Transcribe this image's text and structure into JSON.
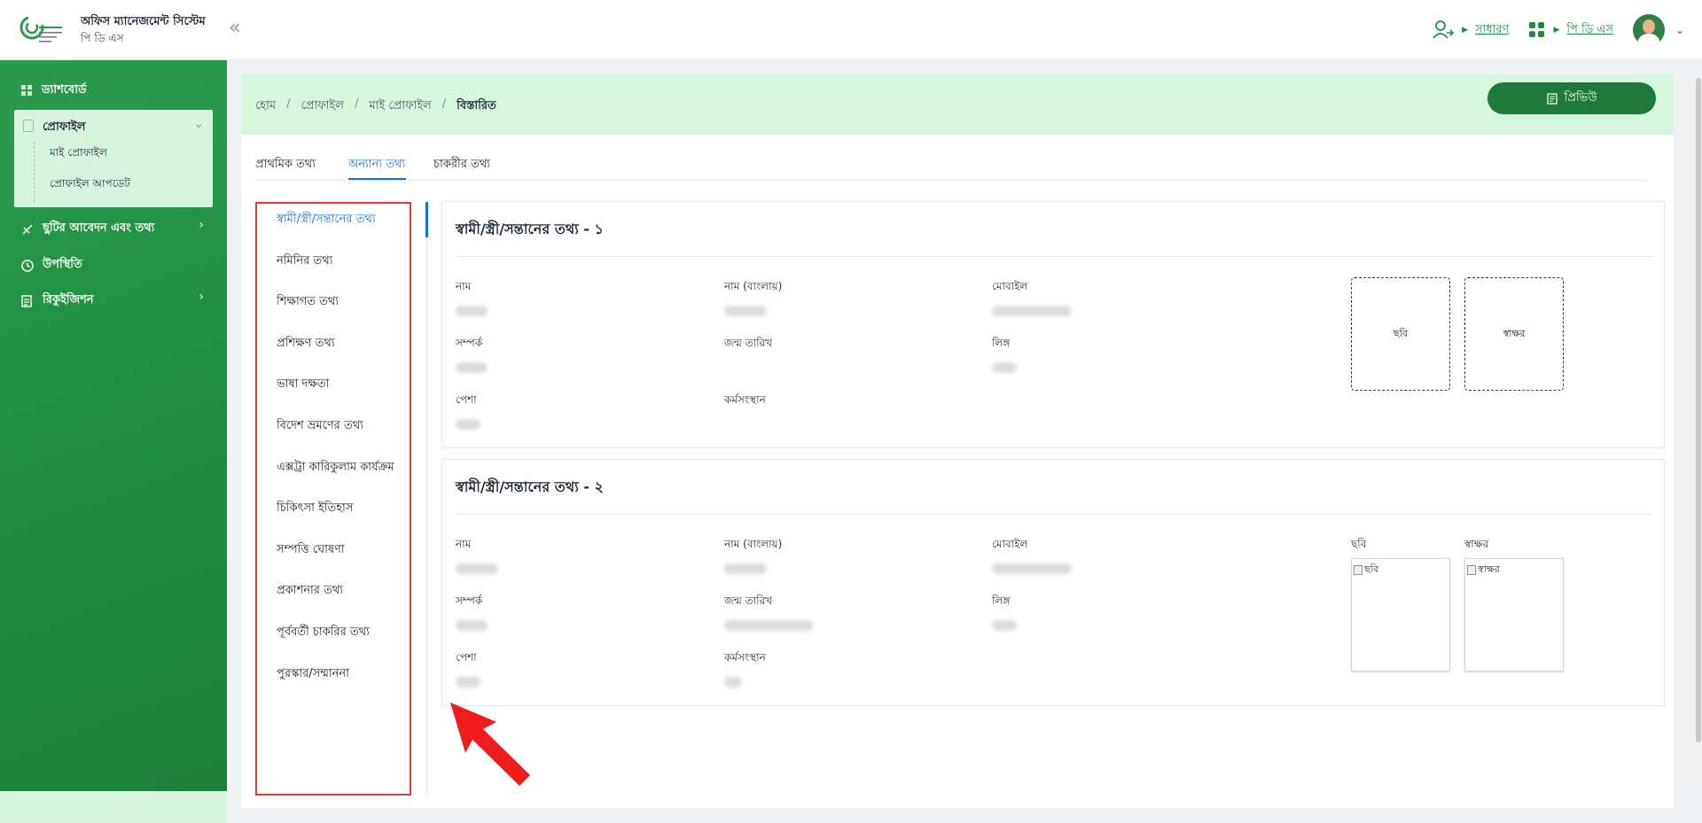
{
  "header": {
    "app_title": "অফিস ম্যানেজমেন্ট সিস্টেম",
    "app_subtitle": "পি ডি এস",
    "role_link": "সাধারণ",
    "module_link": "পি ডি এস",
    "accent": "#1a8f3e"
  },
  "sidebar": {
    "dashboard": "ড্যাশবোর্ড",
    "profile": "প্রোফাইল",
    "my_profile": "মাই প্রোফাইল",
    "profile_update": "প্রোফাইল আপডেট",
    "leave": "ছুটির আবেদন এবং তথ্য",
    "attendance": "উপস্থিতি",
    "requisition": "রিকুইজিশন"
  },
  "breadcrumb": {
    "home": "হোম",
    "profile": "প্রোফাইল",
    "my_profile": "মাই প্রোফাইল",
    "current": "বিস্তারিত"
  },
  "preview_button": "প্রিভিউ",
  "tabs": {
    "basic": "প্রাথমিক তথ্য",
    "other": "অন্যান্য তথ্য",
    "job": "চাকরীর তথ্য"
  },
  "side_menu": [
    "স্বামী/স্ত্রী/সন্তানের তথ্য",
    "নমিনির তথ্য",
    "শিক্ষাগত তথ্য",
    "প্রশিক্ষণ তথ্য",
    "ভাষা দক্ষতা",
    "বিদেশ ভ্রমণের তথ্য",
    "এক্সট্রা কারিকুলাম কার্যক্রম",
    "চিকিৎসা ইতিহাস",
    "সম্পত্তি ঘোষণা",
    "প্রকাশনার তথ্য",
    "পূর্ববর্তী চাকরির তথ্য",
    "পুরস্কার/সম্মাননা"
  ],
  "labels": {
    "name": "নাম",
    "name_bn": "নাম (বাংলায়)",
    "mobile": "মোবাইল",
    "relation": "সম্পর্ক",
    "dob": "জন্ম তারিখ",
    "gender": "লিঙ্গ",
    "occupation": "পেশা",
    "employment": "কর্মসংস্থান",
    "photo": "ছবি",
    "signature": "স্বাক্ষর"
  },
  "cards": [
    {
      "title": "স্বামী/স্ত্রী/সন্তানের তথ্য - ১"
    },
    {
      "title": "স্বামী/স্ত্রী/সন্তানের তথ্য - ২"
    }
  ]
}
